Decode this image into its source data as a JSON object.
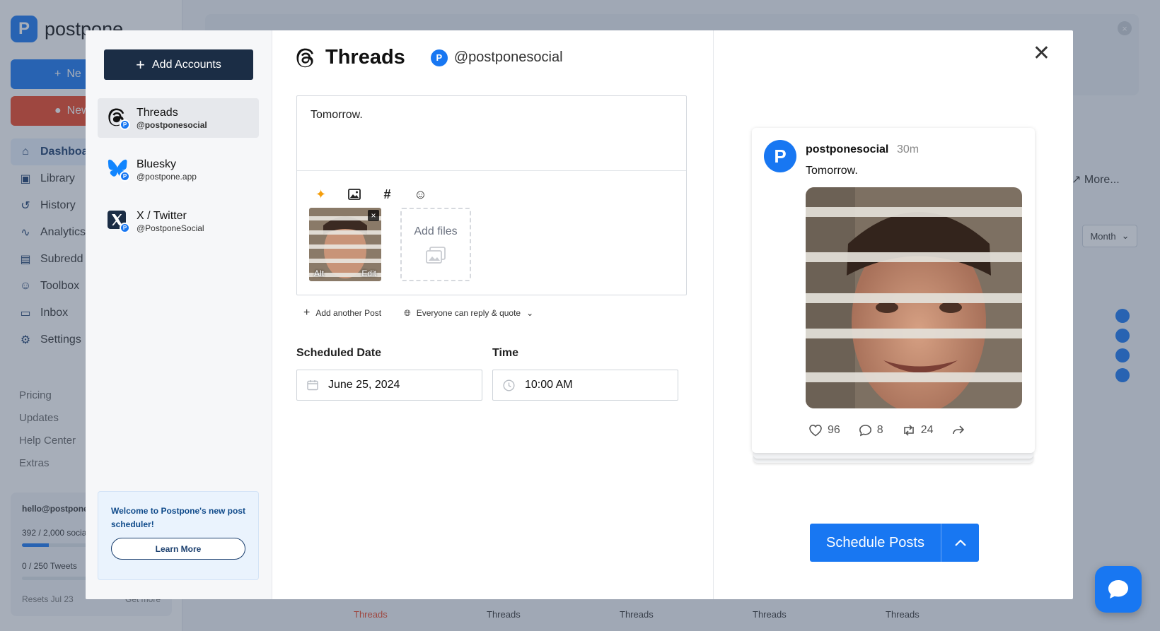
{
  "background": {
    "logo_text": "postpone",
    "new_post_label": "Ne",
    "new_reddit_label": "New",
    "nav": [
      {
        "label": "Dashboa",
        "icon": "home-icon",
        "glyph": "⌂"
      },
      {
        "label": "Library",
        "icon": "image-icon",
        "glyph": "▣"
      },
      {
        "label": "History",
        "icon": "history-icon",
        "glyph": "↺"
      },
      {
        "label": "Analytics",
        "icon": "chart-icon",
        "glyph": "∿"
      },
      {
        "label": "Subredd",
        "icon": "subreddit-icon",
        "glyph": "▤"
      },
      {
        "label": "Toolbox",
        "icon": "toolbox-icon",
        "glyph": "☺"
      },
      {
        "label": "Inbox",
        "icon": "inbox-icon",
        "glyph": "▭"
      },
      {
        "label": "Settings",
        "icon": "gear-icon",
        "glyph": "⚙"
      }
    ],
    "links": [
      "Pricing",
      "Updates",
      "Help Center",
      "Extras"
    ],
    "user_email": "hello@postpone",
    "social_usage": "392 / 2,000 socia",
    "social_usage_fraction": 0.196,
    "tweets_usage": "0 / 250 Tweets",
    "tweets_usage_fraction": 0,
    "resets": "Resets Jul 23",
    "get_more": "Get more",
    "more": "More...",
    "month": "Month",
    "calendar_cells": [
      {
        "label": "Threads",
        "tone": "red"
      },
      {
        "label": "Threads",
        "tone": "n"
      },
      {
        "label": "Threads",
        "tone": "n"
      },
      {
        "label": "Threads",
        "tone": "n"
      },
      {
        "label": "Threads",
        "tone": "n"
      }
    ]
  },
  "sidebar": {
    "add_accounts": "Add Accounts",
    "accounts": [
      {
        "name": "Threads",
        "handle": "@postponesocial",
        "icon": "threads-icon",
        "active": true
      },
      {
        "name": "Bluesky",
        "handle": "@postpone.app",
        "icon": "bluesky-icon",
        "active": false
      },
      {
        "name": "X / Twitter",
        "handle": "@PostponeSocial",
        "icon": "x-twitter-icon",
        "active": false
      }
    ],
    "welcome": "Welcome to Postpone's new post scheduler!",
    "learn_more": "Learn More"
  },
  "composer": {
    "title": "Threads",
    "handle": "@postponesocial",
    "text": "Tomorrow.",
    "toolbar": [
      "ai-sparkle-icon",
      "image-icon",
      "hashtag-icon",
      "emoji-icon"
    ],
    "thumb_alt": "Alt",
    "thumb_edit": "Edit",
    "add_files": "Add files",
    "add_another_post": "Add another Post",
    "reply_setting": "Everyone can reply & quote",
    "scheduled_date_label": "Scheduled Date",
    "scheduled_date": "June 25, 2024",
    "time_label": "Time",
    "time": "10:00 AM"
  },
  "preview": {
    "name": "postponesocial",
    "time": "30m",
    "text": "Tomorrow.",
    "likes": "96",
    "comments": "8",
    "reposts": "24"
  },
  "actions": {
    "schedule": "Schedule Posts"
  },
  "colors": {
    "brand": "#1877f2",
    "navy": "#1b2d45",
    "reddit": "#ef4423"
  }
}
